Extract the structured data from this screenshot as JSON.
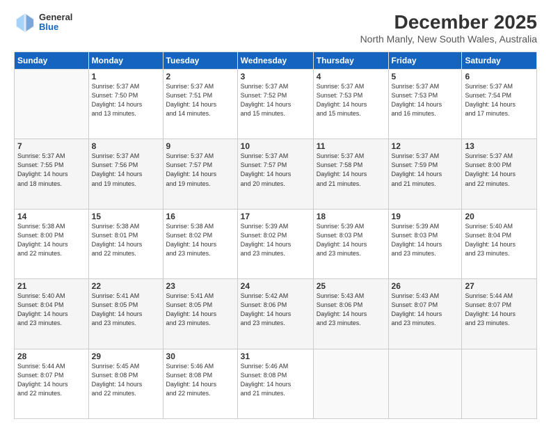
{
  "logo": {
    "general": "General",
    "blue": "Blue"
  },
  "header": {
    "month_title": "December 2025",
    "location": "North Manly, New South Wales, Australia"
  },
  "days_of_week": [
    "Sunday",
    "Monday",
    "Tuesday",
    "Wednesday",
    "Thursday",
    "Friday",
    "Saturday"
  ],
  "weeks": [
    [
      {
        "day": "",
        "info": ""
      },
      {
        "day": "1",
        "info": "Sunrise: 5:37 AM\nSunset: 7:50 PM\nDaylight: 14 hours\nand 13 minutes."
      },
      {
        "day": "2",
        "info": "Sunrise: 5:37 AM\nSunset: 7:51 PM\nDaylight: 14 hours\nand 14 minutes."
      },
      {
        "day": "3",
        "info": "Sunrise: 5:37 AM\nSunset: 7:52 PM\nDaylight: 14 hours\nand 15 minutes."
      },
      {
        "day": "4",
        "info": "Sunrise: 5:37 AM\nSunset: 7:53 PM\nDaylight: 14 hours\nand 15 minutes."
      },
      {
        "day": "5",
        "info": "Sunrise: 5:37 AM\nSunset: 7:53 PM\nDaylight: 14 hours\nand 16 minutes."
      },
      {
        "day": "6",
        "info": "Sunrise: 5:37 AM\nSunset: 7:54 PM\nDaylight: 14 hours\nand 17 minutes."
      }
    ],
    [
      {
        "day": "7",
        "info": "Sunrise: 5:37 AM\nSunset: 7:55 PM\nDaylight: 14 hours\nand 18 minutes."
      },
      {
        "day": "8",
        "info": "Sunrise: 5:37 AM\nSunset: 7:56 PM\nDaylight: 14 hours\nand 19 minutes."
      },
      {
        "day": "9",
        "info": "Sunrise: 5:37 AM\nSunset: 7:57 PM\nDaylight: 14 hours\nand 19 minutes."
      },
      {
        "day": "10",
        "info": "Sunrise: 5:37 AM\nSunset: 7:57 PM\nDaylight: 14 hours\nand 20 minutes."
      },
      {
        "day": "11",
        "info": "Sunrise: 5:37 AM\nSunset: 7:58 PM\nDaylight: 14 hours\nand 21 minutes."
      },
      {
        "day": "12",
        "info": "Sunrise: 5:37 AM\nSunset: 7:59 PM\nDaylight: 14 hours\nand 21 minutes."
      },
      {
        "day": "13",
        "info": "Sunrise: 5:37 AM\nSunset: 8:00 PM\nDaylight: 14 hours\nand 22 minutes."
      }
    ],
    [
      {
        "day": "14",
        "info": "Sunrise: 5:38 AM\nSunset: 8:00 PM\nDaylight: 14 hours\nand 22 minutes."
      },
      {
        "day": "15",
        "info": "Sunrise: 5:38 AM\nSunset: 8:01 PM\nDaylight: 14 hours\nand 22 minutes."
      },
      {
        "day": "16",
        "info": "Sunrise: 5:38 AM\nSunset: 8:02 PM\nDaylight: 14 hours\nand 23 minutes."
      },
      {
        "day": "17",
        "info": "Sunrise: 5:39 AM\nSunset: 8:02 PM\nDaylight: 14 hours\nand 23 minutes."
      },
      {
        "day": "18",
        "info": "Sunrise: 5:39 AM\nSunset: 8:03 PM\nDaylight: 14 hours\nand 23 minutes."
      },
      {
        "day": "19",
        "info": "Sunrise: 5:39 AM\nSunset: 8:03 PM\nDaylight: 14 hours\nand 23 minutes."
      },
      {
        "day": "20",
        "info": "Sunrise: 5:40 AM\nSunset: 8:04 PM\nDaylight: 14 hours\nand 23 minutes."
      }
    ],
    [
      {
        "day": "21",
        "info": "Sunrise: 5:40 AM\nSunset: 8:04 PM\nDaylight: 14 hours\nand 23 minutes."
      },
      {
        "day": "22",
        "info": "Sunrise: 5:41 AM\nSunset: 8:05 PM\nDaylight: 14 hours\nand 23 minutes."
      },
      {
        "day": "23",
        "info": "Sunrise: 5:41 AM\nSunset: 8:05 PM\nDaylight: 14 hours\nand 23 minutes."
      },
      {
        "day": "24",
        "info": "Sunrise: 5:42 AM\nSunset: 8:06 PM\nDaylight: 14 hours\nand 23 minutes."
      },
      {
        "day": "25",
        "info": "Sunrise: 5:43 AM\nSunset: 8:06 PM\nDaylight: 14 hours\nand 23 minutes."
      },
      {
        "day": "26",
        "info": "Sunrise: 5:43 AM\nSunset: 8:07 PM\nDaylight: 14 hours\nand 23 minutes."
      },
      {
        "day": "27",
        "info": "Sunrise: 5:44 AM\nSunset: 8:07 PM\nDaylight: 14 hours\nand 23 minutes."
      }
    ],
    [
      {
        "day": "28",
        "info": "Sunrise: 5:44 AM\nSunset: 8:07 PM\nDaylight: 14 hours\nand 22 minutes."
      },
      {
        "day": "29",
        "info": "Sunrise: 5:45 AM\nSunset: 8:08 PM\nDaylight: 14 hours\nand 22 minutes."
      },
      {
        "day": "30",
        "info": "Sunrise: 5:46 AM\nSunset: 8:08 PM\nDaylight: 14 hours\nand 22 minutes."
      },
      {
        "day": "31",
        "info": "Sunrise: 5:46 AM\nSunset: 8:08 PM\nDaylight: 14 hours\nand 21 minutes."
      },
      {
        "day": "",
        "info": ""
      },
      {
        "day": "",
        "info": ""
      },
      {
        "day": "",
        "info": ""
      }
    ]
  ]
}
